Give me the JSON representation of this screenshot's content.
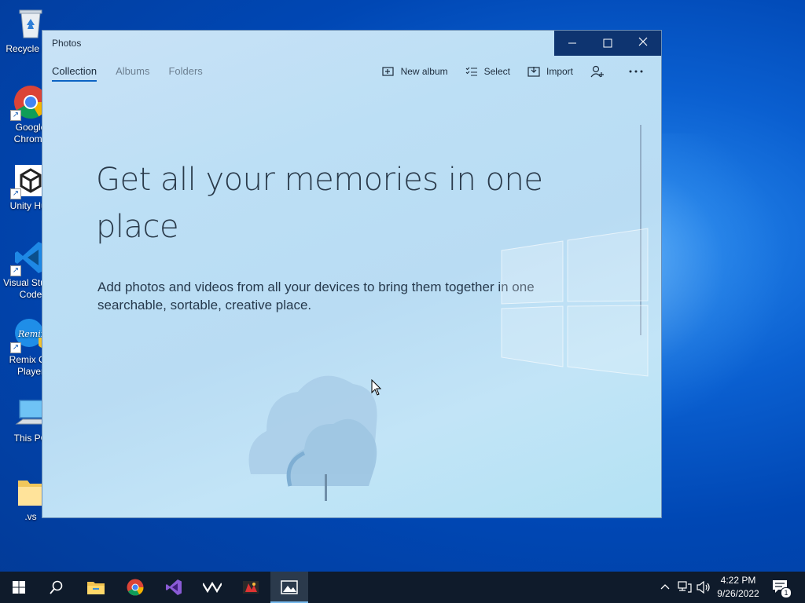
{
  "desktop": {
    "icons": [
      {
        "label": "Recycle Bin",
        "icon": "recycle-bin-icon"
      },
      {
        "label": "Google Chrome",
        "icon": "chrome-icon"
      },
      {
        "label": "Unity Hub",
        "icon": "unity-hub-icon"
      },
      {
        "label": "Visual Studio Code",
        "icon": "vscode-icon"
      },
      {
        "label": "Remix OS Player",
        "icon": "remix-os-icon"
      },
      {
        "label": "This PC",
        "icon": "this-pc-icon"
      },
      {
        "label": ".vs",
        "icon": "folder-icon"
      }
    ]
  },
  "window": {
    "title": "Photos",
    "tabs": [
      {
        "label": "Collection",
        "active": true
      },
      {
        "label": "Albums",
        "active": false
      },
      {
        "label": "Folders",
        "active": false
      }
    ],
    "toolbar": {
      "new_album": "New album",
      "select": "Select",
      "import": "Import",
      "people_icon": "person-add-icon",
      "more_icon": "more-icon"
    },
    "heading": "Get all your memories in one place",
    "subtext": "Add photos and videos from all your devices to bring them together in one searchable, sortable, creative place."
  },
  "taskbar": {
    "apps": [
      "start-icon",
      "search-icon",
      "file-explorer-icon",
      "chrome-icon",
      "visual-studio-icon",
      "unity-icon",
      "game-icon",
      "photos-icon"
    ],
    "time": "4:22 PM",
    "date": "9/26/2022",
    "notification_count": "1"
  },
  "colors": {
    "accent": "#0b63c4",
    "caption_bar": "#0e3470",
    "taskbar": "#0f1b2b"
  }
}
